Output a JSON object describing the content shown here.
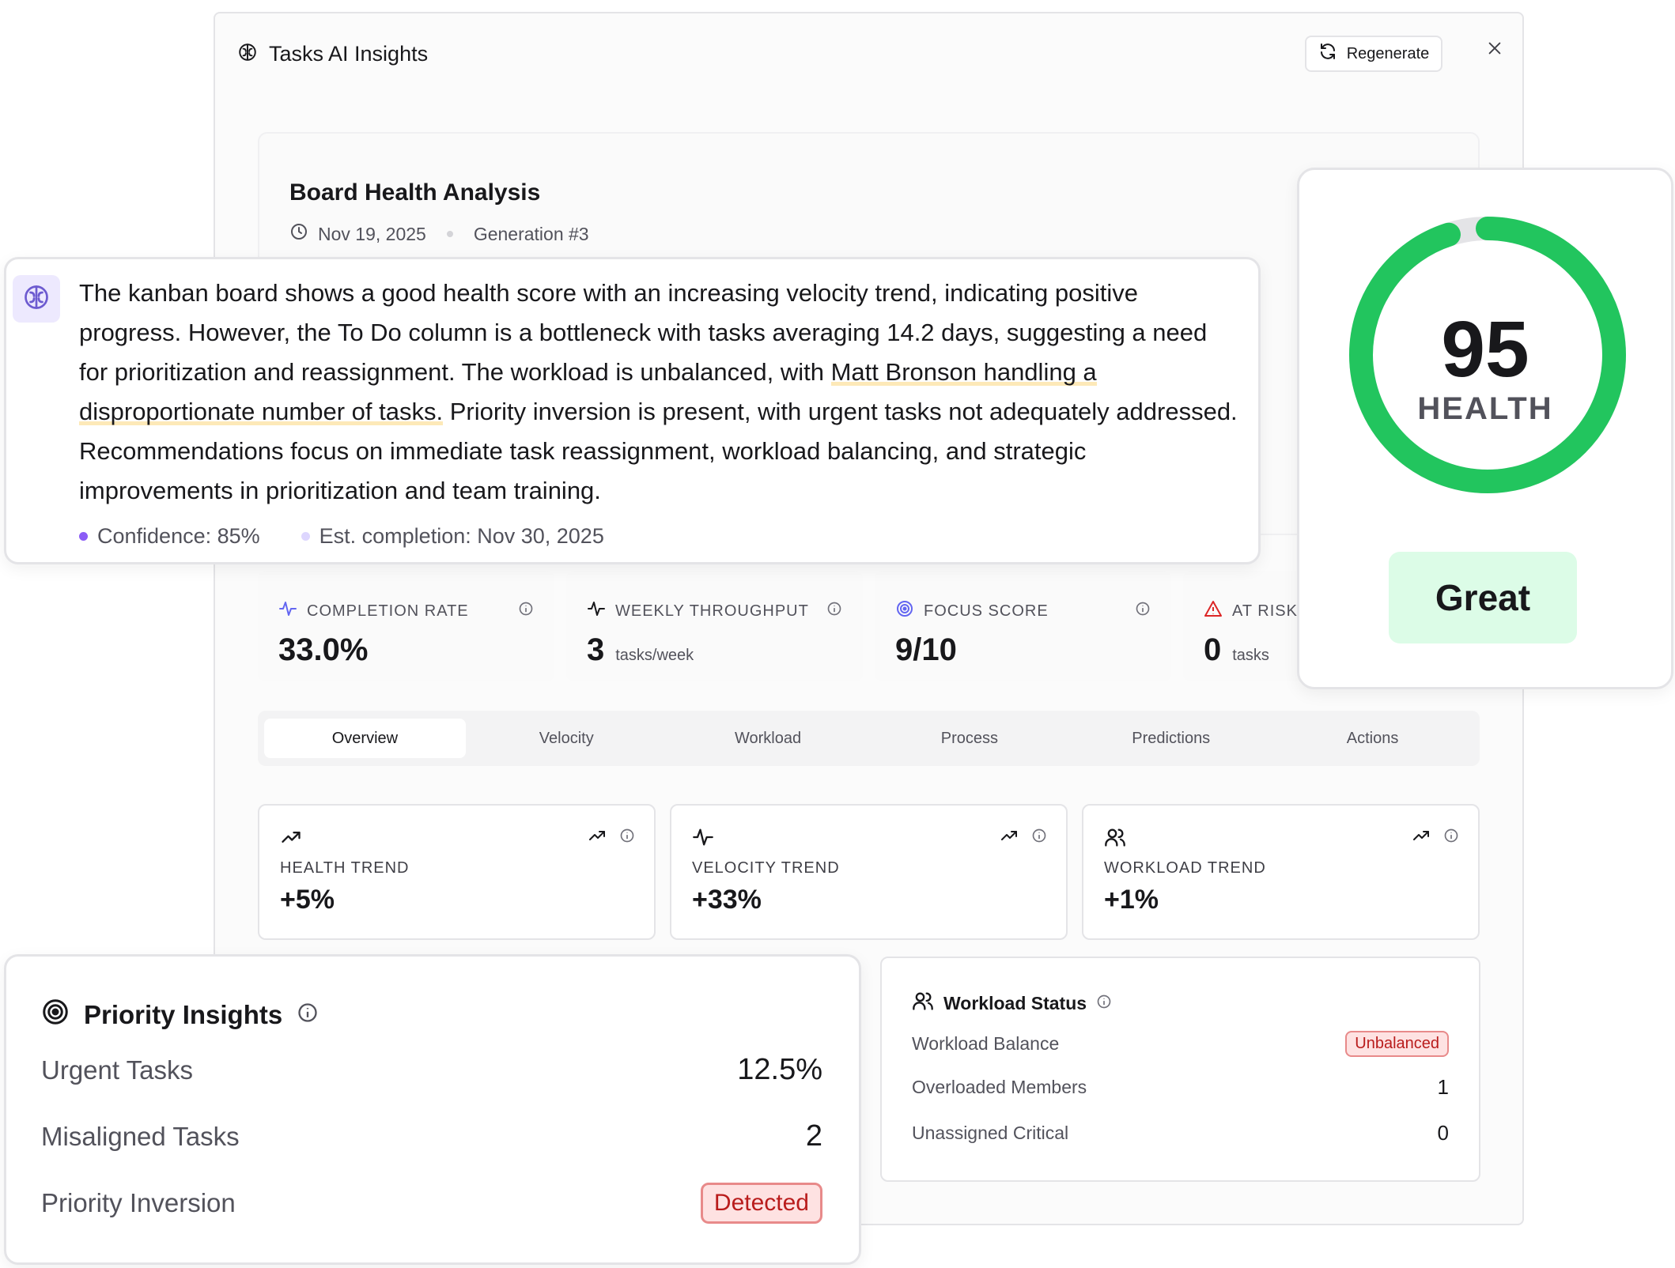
{
  "modal": {
    "title": "Tasks AI Insights",
    "regenerate_label": "Regenerate"
  },
  "analysis": {
    "title": "Board Health Analysis",
    "date": "Nov 19, 2025",
    "generation": "Generation #3"
  },
  "summary": {
    "text_before": "The kanban board shows a good health score with an increasing velocity trend, indicating positive progress. However, the To Do column is a bottleneck with tasks averaging 14.2 days, suggesting a need for prioritization and reassignment. The workload is unbalanced, with ",
    "text_highlight": "Matt Bronson handling a disproportionate number of tasks.",
    "text_after": " Priority inversion is present, with urgent tasks not adequately addressed. Recommendations focus on immediate task reassignment, workload balancing, and strategic improvements in prioritization and team training.",
    "confidence": "Confidence: 85%",
    "est_completion": "Est. completion: Nov 30, 2025",
    "colors": {
      "confidence_dot": "#8b5cf6",
      "est_dot": "#ddd6fe"
    }
  },
  "health": {
    "score": "95",
    "score_fraction": 0.95,
    "label": "HEALTH",
    "rating": "Great",
    "colors": {
      "ring": "#22c55e",
      "track": "#e4e4e7",
      "rating_bg": "#dcfce7"
    }
  },
  "metrics": [
    {
      "label": "COMPLETION RATE",
      "value": "33.0%",
      "unit": "",
      "icon": "activity-icon"
    },
    {
      "label": "WEEKLY THROUGHPUT",
      "value": "3",
      "unit": "tasks/week",
      "icon": "activity-icon"
    },
    {
      "label": "FOCUS SCORE",
      "value": "9/10",
      "unit": "",
      "icon": "target-icon"
    },
    {
      "label": "AT RISK",
      "value": "0",
      "unit": "tasks",
      "icon": "alert-triangle-icon"
    }
  ],
  "tabs": [
    {
      "label": "Overview",
      "active": true
    },
    {
      "label": "Velocity",
      "active": false
    },
    {
      "label": "Workload",
      "active": false
    },
    {
      "label": "Process",
      "active": false
    },
    {
      "label": "Predictions",
      "active": false
    },
    {
      "label": "Actions",
      "active": false
    }
  ],
  "trends": [
    {
      "label": "HEALTH TREND",
      "value": "+5%",
      "icon": "trending-up-icon"
    },
    {
      "label": "VELOCITY TREND",
      "value": "+33%",
      "icon": "activity-icon"
    },
    {
      "label": "WORKLOAD TREND",
      "value": "+1%",
      "icon": "users-icon"
    }
  ],
  "priority": {
    "title": "Priority Insights",
    "rows": [
      {
        "label": "Urgent Tasks",
        "value": "12.5%"
      },
      {
        "label": "Misaligned Tasks",
        "value": "2"
      },
      {
        "label": "Priority Inversion",
        "value": "Detected"
      }
    ]
  },
  "workload": {
    "title": "Workload Status",
    "rows": [
      {
        "label": "Workload Balance",
        "value": "Unbalanced"
      },
      {
        "label": "Overloaded Members",
        "value": "1"
      },
      {
        "label": "Unassigned Critical",
        "value": "0"
      }
    ]
  }
}
